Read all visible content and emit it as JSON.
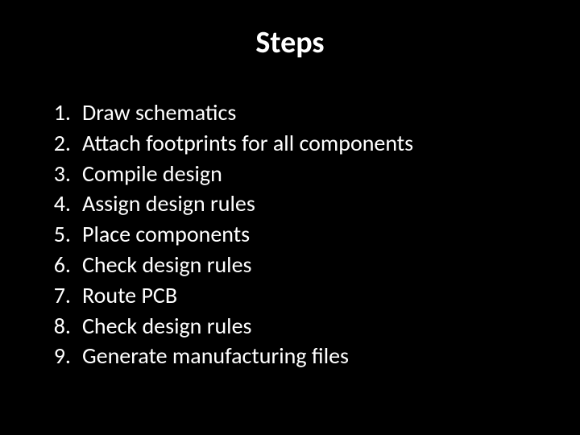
{
  "title": "Steps",
  "steps": [
    {
      "num": "1.",
      "text": "Draw schematics"
    },
    {
      "num": "2.",
      "text": "Attach footprints for all components"
    },
    {
      "num": "3.",
      "text": "Compile design"
    },
    {
      "num": "4.",
      "text": "Assign design rules"
    },
    {
      "num": "5.",
      "text": "Place components"
    },
    {
      "num": "6.",
      "text": "Check design rules"
    },
    {
      "num": "7.",
      "text": "Route PCB"
    },
    {
      "num": "8.",
      "text": "Check design rules"
    },
    {
      "num": "9.",
      "text": "Generate manufacturing files"
    }
  ]
}
